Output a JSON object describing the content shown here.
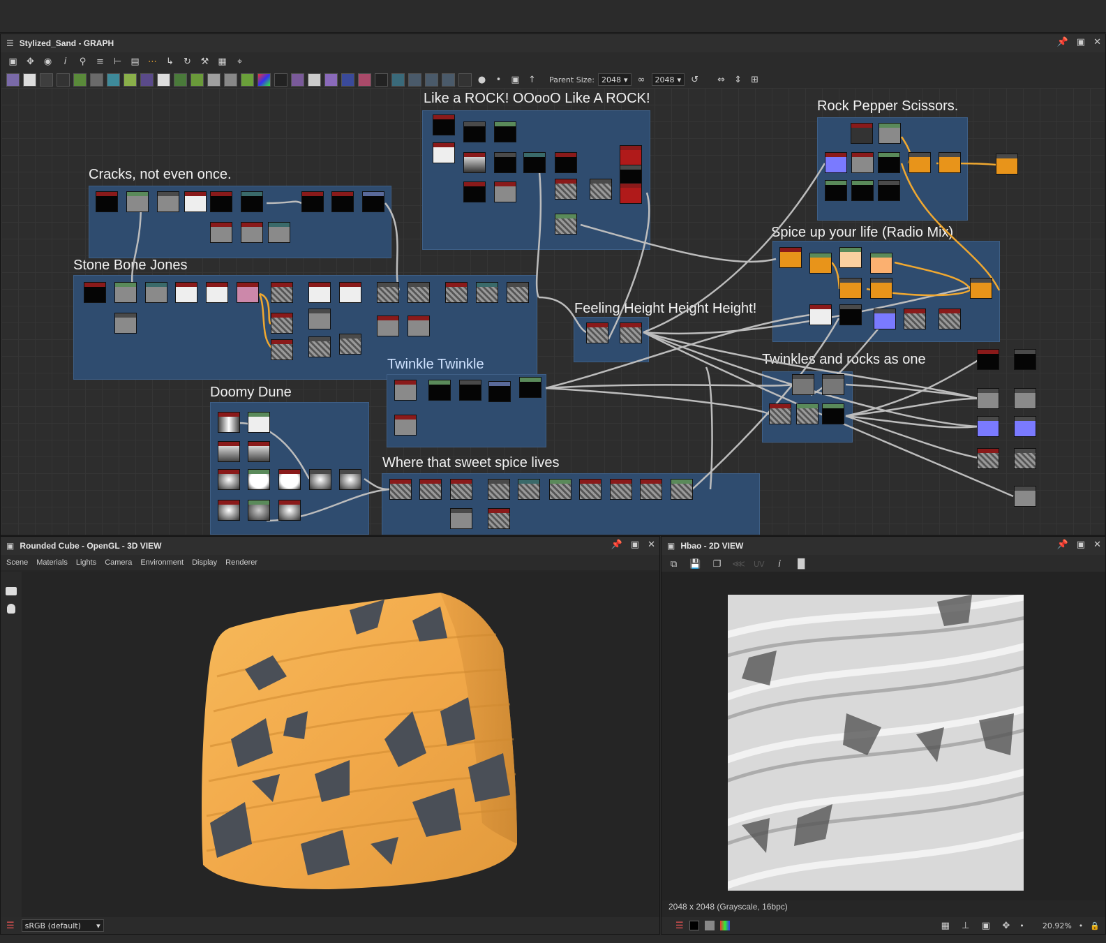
{
  "graph": {
    "title": "Stylized_Sand - GRAPH",
    "parent_size_label": "Parent Size:",
    "parent_size_value": "2048",
    "output_size_value": "2048",
    "frames": [
      "Like a ROCK! OOooO Like A ROCK!",
      "Rock Pepper Scissors.",
      "Cracks, not even once.",
      "Stone Bone Jones",
      "Spice up your life (Radio Mix)",
      "Feeling Height Height Height!",
      "Twinkle Twinkle",
      "Twinkles and rocks as one",
      "Doomy Dune",
      "Where that sweet spice lives"
    ]
  },
  "view3d": {
    "title": "Rounded Cube - OpenGL - 3D VIEW",
    "menu": [
      "Scene",
      "Materials",
      "Lights",
      "Camera",
      "Environment",
      "Display",
      "Renderer"
    ],
    "colorspace": "sRGB (default)"
  },
  "view2d": {
    "title": "Hbao - 2D VIEW",
    "uv_label": "UV",
    "image_info": "2048 x 2048 (Grayscale, 16bpc)",
    "zoom": "20.92%"
  },
  "colors": {
    "frame_fill": "#2f4c6f",
    "link": "#bdbdbd",
    "link_orange": "#f0a830",
    "sand": "#f2a94a",
    "rock": "#4a4f57"
  }
}
